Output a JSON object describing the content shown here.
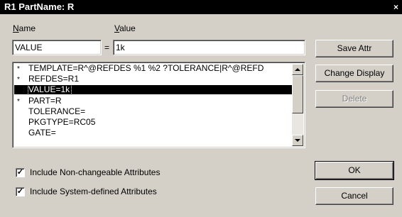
{
  "title": {
    "text": "R1   PartName: R",
    "close_glyph": "×"
  },
  "labels": {
    "name": "Name",
    "name_mnemonic_index": 0,
    "value": "Value",
    "value_mnemonic_index": 0,
    "equals": "="
  },
  "fields": {
    "name": "VALUE",
    "value": "1k"
  },
  "attributes": [
    {
      "star": "*",
      "text": "TEMPLATE=R^@REFDES %1 %2 ?TOLERANCE|R^@REFD",
      "selected": false
    },
    {
      "star": "*",
      "text": "REFDES=R1",
      "selected": false
    },
    {
      "star": "",
      "text": "VALUE=1k",
      "selected": true
    },
    {
      "star": "*",
      "text": "PART=R",
      "selected": false
    },
    {
      "star": "",
      "text": "TOLERANCE=",
      "selected": false
    },
    {
      "star": "",
      "text": "PKGTYPE=RC05",
      "selected": false
    },
    {
      "star": "",
      "text": "GATE=",
      "selected": false
    }
  ],
  "buttons": {
    "save_attr": "Save Attr",
    "change_display": "Change Display",
    "delete": "Delete",
    "ok": "OK",
    "cancel": "Cancel"
  },
  "checkboxes": {
    "nonchangeable": {
      "label": "Include Non-changeable Attributes",
      "checked": true
    },
    "system": {
      "label": "Include System-defined Attributes",
      "checked": true
    }
  },
  "scroll_icons": {
    "up": "up-arrow",
    "down": "down-arrow"
  }
}
